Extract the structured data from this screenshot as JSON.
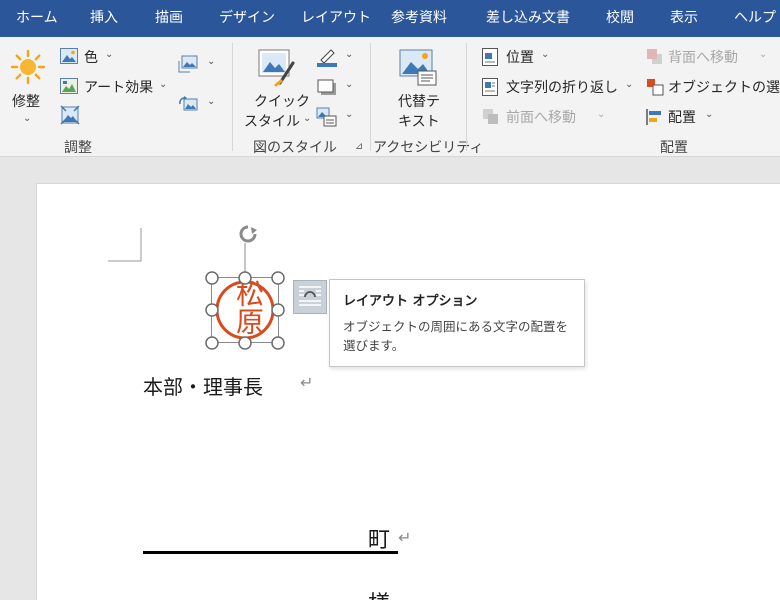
{
  "tabs": [
    "ホーム",
    "挿入",
    "描画",
    "デザイン",
    "レイアウト",
    "参考資料",
    "差し込み文書",
    "校閲",
    "表示",
    "ヘルプ"
  ],
  "ribbon": {
    "adjust": {
      "fix_label": "修整",
      "color_label": "色",
      "art_effects_label": "アート効果",
      "group_label": "調整"
    },
    "styles": {
      "quick_style_line1": "クイック",
      "quick_style_line2": "スタイル",
      "group_label": "図のスタイル"
    },
    "accessibility": {
      "alt_text_line1": "代替テ",
      "alt_text_line2": "キスト",
      "group_label": "アクセシビリティ"
    },
    "arrange": {
      "position_label": "位置",
      "wrap_text_label": "文字列の折り返し",
      "bring_forward_label": "前面へ移動",
      "send_backward_label": "背面へ移動",
      "selection_pane_label": "オブジェクトの選択と表示",
      "align_label": "配置",
      "group_label": "配置"
    }
  },
  "document": {
    "seal_text": "松原",
    "line1": "本部・理事長",
    "line2": "町",
    "line3_partial": "様",
    "paragraph_mark": "↵"
  },
  "tooltip": {
    "title": "レイアウト オプション",
    "body": "オブジェクトの周囲にある文字の配置を選びます。"
  },
  "colors": {
    "titlebar": "#2b579a",
    "ribbon_bg": "#f3f3f3",
    "seal_red": "#d94a1e",
    "handle": "#6b6b6b"
  }
}
